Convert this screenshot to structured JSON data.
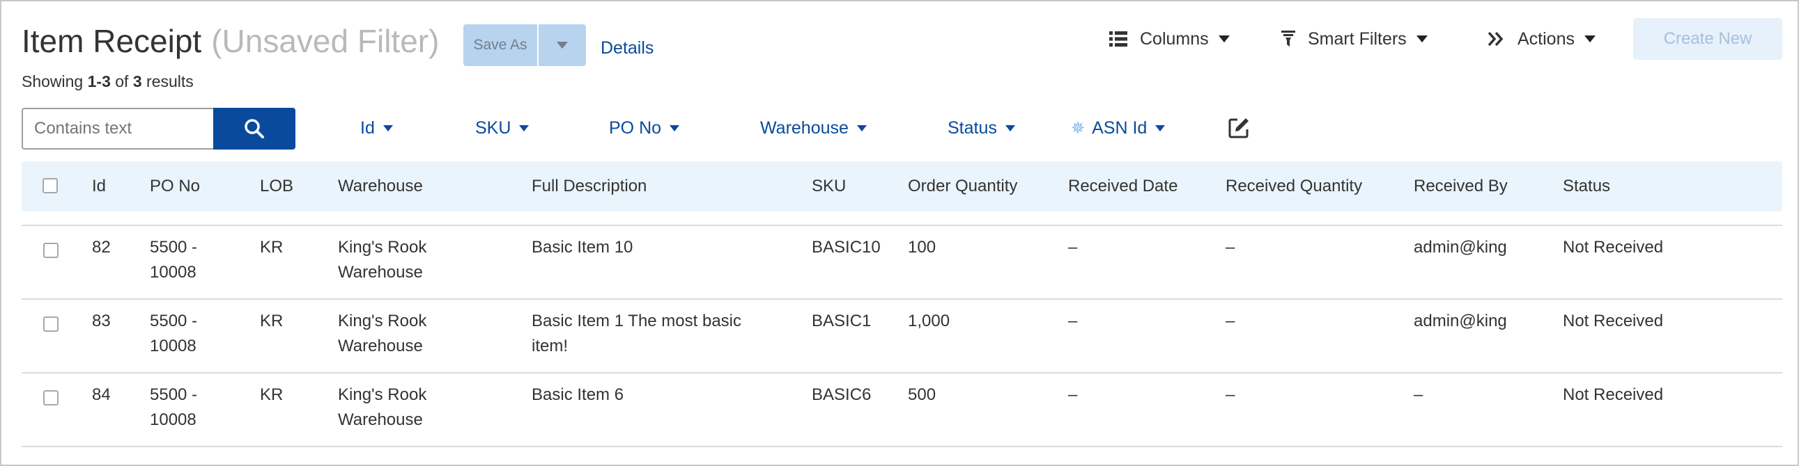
{
  "header": {
    "title": "Item Receipt",
    "subtitle": "(Unsaved Filter)",
    "save_as_label": "Save As",
    "details_label": "Details",
    "results_prefix": "Showing ",
    "results_range": "1-3",
    "results_of": " of ",
    "results_total": "3",
    "results_suffix": " results"
  },
  "toolbar": {
    "columns_label": "Columns",
    "smart_filters_label": "Smart Filters",
    "actions_label": "Actions",
    "create_new_label": "Create New"
  },
  "search": {
    "placeholder": "Contains text",
    "value": ""
  },
  "filters": [
    {
      "label": "Id"
    },
    {
      "label": "SKU"
    },
    {
      "label": "PO No"
    },
    {
      "label": "Warehouse"
    },
    {
      "label": "Status"
    },
    {
      "label": "ASN Id"
    }
  ],
  "table": {
    "columns": [
      "Id",
      "PO No",
      "LOB",
      "Warehouse",
      "Full Description",
      "SKU",
      "Order Quantity",
      "Received Date",
      "Received Quantity",
      "Received By",
      "Status"
    ],
    "rows": [
      {
        "id": "82",
        "po_no_line1": "5500 -",
        "po_no_line2": "10008",
        "lob": "KR",
        "warehouse_line1": "King's Rook",
        "warehouse_line2": "Warehouse",
        "description_line1": "Basic Item 10",
        "description_line2": "",
        "sku": "BASIC10",
        "order_quantity": "100",
        "received_date": "–",
        "received_quantity": "–",
        "received_by": "admin@king",
        "status": "Not Received"
      },
      {
        "id": "83",
        "po_no_line1": "5500 -",
        "po_no_line2": "10008",
        "lob": "KR",
        "warehouse_line1": "King's Rook",
        "warehouse_line2": "Warehouse",
        "description_line1": "Basic Item 1 The most basic",
        "description_line2": "item!",
        "sku": "BASIC1",
        "order_quantity": "1,000",
        "received_date": "–",
        "received_quantity": "–",
        "received_by": "admin@king",
        "status": "Not Received"
      },
      {
        "id": "84",
        "po_no_line1": "5500 -",
        "po_no_line2": "10008",
        "lob": "KR",
        "warehouse_line1": "King's Rook",
        "warehouse_line2": "Warehouse",
        "description_line1": "Basic Item 6",
        "description_line2": "",
        "sku": "BASIC6",
        "order_quantity": "500",
        "received_date": "–",
        "received_quantity": "–",
        "received_by": "–",
        "status": "Not Received"
      }
    ]
  },
  "icons": {
    "columns": "list-icon",
    "smart_filters": "funnel-icon",
    "actions": "double-chevron-right-icon",
    "search": "search-icon",
    "asn_star": "snowflake-icon",
    "edit": "edit-icon"
  },
  "colors": {
    "brand_blue": "#0a4a9c",
    "header_row_bg": "#eaf4fc",
    "disabled_button_bg": "#b7d3ee",
    "create_new_bg": "#e6f1fb",
    "subtitle_gray": "#b9b9b9"
  }
}
